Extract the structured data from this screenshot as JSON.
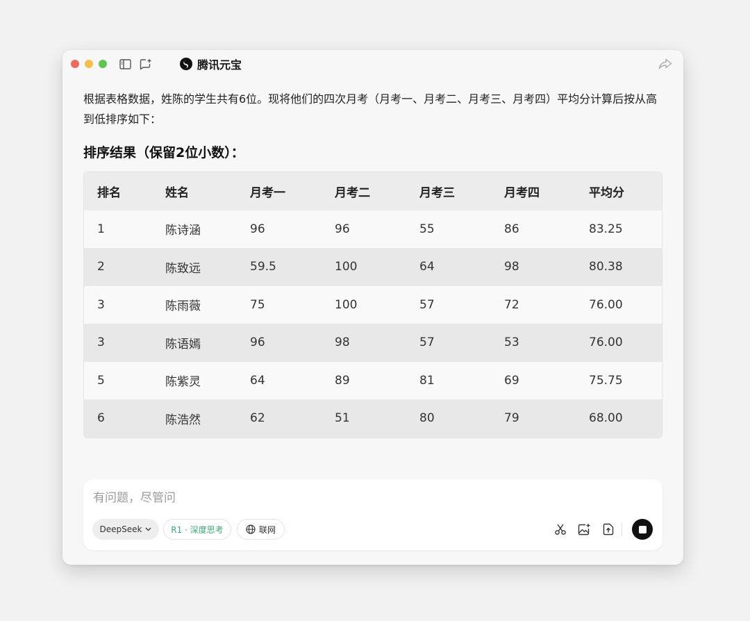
{
  "window": {
    "traffic_colors": {
      "close": "#ee6a5f",
      "minimize": "#f5bf4f",
      "zoom": "#61c554"
    }
  },
  "titlebar": {
    "app_name": "腾讯元宝",
    "icons": [
      "sidebar-toggle-icon",
      "new-chat-icon",
      "yuanbao-logo-icon",
      "share-icon"
    ]
  },
  "message": {
    "intro": "根据表格数据，姓陈的学生共有6位。现将他们的四次月考（月考一、月考二、月考三、月考四）平均分计算后按从高到低排序如下：",
    "section_title": "排序结果（保留2位小数）："
  },
  "table": {
    "headers": [
      "排名",
      "姓名",
      "月考一",
      "月考二",
      "月考三",
      "月考四",
      "平均分"
    ],
    "rows": [
      [
        "1",
        "陈诗涵",
        "96",
        "96",
        "55",
        "86",
        "83.25"
      ],
      [
        "2",
        "陈致远",
        "59.5",
        "100",
        "64",
        "98",
        "80.38"
      ],
      [
        "3",
        "陈雨薇",
        "75",
        "100",
        "57",
        "72",
        "76.00"
      ],
      [
        "3",
        "陈语嫣",
        "96",
        "98",
        "57",
        "53",
        "76.00"
      ],
      [
        "5",
        "陈紫灵",
        "64",
        "89",
        "81",
        "69",
        "75.75"
      ],
      [
        "6",
        "陈浩然",
        "62",
        "51",
        "80",
        "79",
        "68.00"
      ]
    ]
  },
  "composer": {
    "placeholder": "有问题，尽管问",
    "model_label": "DeepSeek",
    "think_label": "R1 · 深度思考",
    "web_label": "联网",
    "accent_color": "#3fa877",
    "tools": [
      "scissors-icon",
      "image-add-icon",
      "upload-file-icon",
      "stop-icon"
    ]
  }
}
